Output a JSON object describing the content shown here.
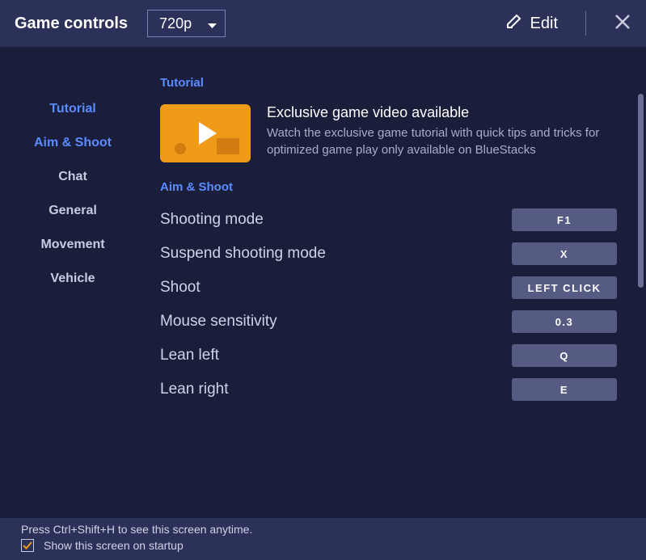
{
  "header": {
    "title": "Game controls",
    "resolution": "720p",
    "edit_label": "Edit"
  },
  "sidebar": {
    "items": [
      {
        "label": "Tutorial",
        "active": true
      },
      {
        "label": "Aim & Shoot",
        "active": true
      },
      {
        "label": "Chat",
        "active": false
      },
      {
        "label": "General",
        "active": false
      },
      {
        "label": "Movement",
        "active": false
      },
      {
        "label": "Vehicle",
        "active": false
      }
    ]
  },
  "content": {
    "tutorial": {
      "section_label": "Tutorial",
      "video_title": "Exclusive game video available",
      "video_desc": "Watch the exclusive game tutorial with quick tips and tricks for optimized game play only available on BlueStacks"
    },
    "aim_shoot": {
      "section_label": "Aim & Shoot",
      "bindings": [
        {
          "label": "Shooting mode",
          "key": "F1"
        },
        {
          "label": "Suspend shooting mode",
          "key": "X"
        },
        {
          "label": "Shoot",
          "key": "LEFT CLICK"
        },
        {
          "label": "Mouse sensitivity",
          "key": "0.3"
        },
        {
          "label": "Lean left",
          "key": "Q"
        },
        {
          "label": "Lean right",
          "key": "E"
        }
      ]
    }
  },
  "footer": {
    "hint": "Press Ctrl+Shift+H to see this screen anytime.",
    "checkbox_label": "Show this screen on startup",
    "checkbox_checked": true
  }
}
